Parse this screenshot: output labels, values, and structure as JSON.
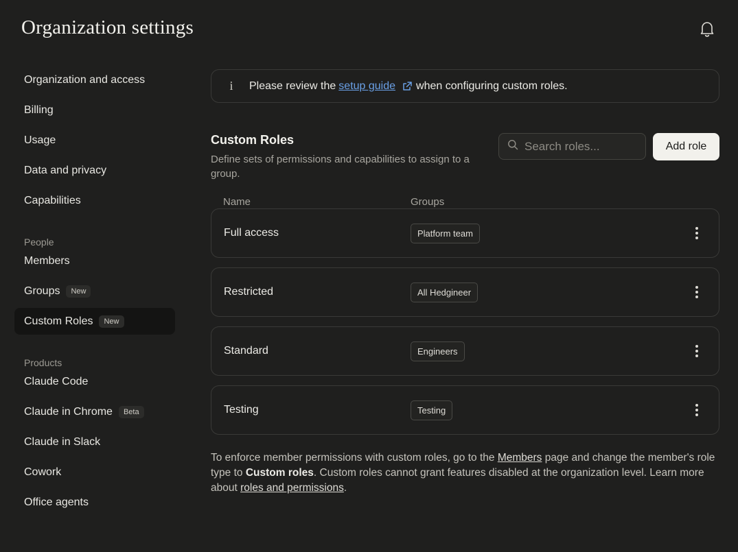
{
  "page_title": "Organization settings",
  "sidebar": {
    "items": [
      {
        "label": "Organization and access"
      },
      {
        "label": "Billing"
      },
      {
        "label": "Usage"
      },
      {
        "label": "Data and privacy"
      },
      {
        "label": "Capabilities"
      }
    ],
    "people_label": "People",
    "people_items": [
      {
        "label": "Members",
        "badge": ""
      },
      {
        "label": "Groups",
        "badge": "New"
      },
      {
        "label": "Custom Roles",
        "badge": "New"
      }
    ],
    "products_label": "Products",
    "product_items": [
      {
        "label": "Claude Code",
        "badge": ""
      },
      {
        "label": "Claude in Chrome",
        "badge": "Beta"
      },
      {
        "label": "Claude in Slack",
        "badge": ""
      },
      {
        "label": "Cowork",
        "badge": ""
      },
      {
        "label": "Office agents",
        "badge": ""
      }
    ]
  },
  "banner": {
    "prefix": "Please review the",
    "link": "setup guide",
    "suffix": "when configuring custom roles."
  },
  "roles": {
    "title": "Custom Roles",
    "description": "Define sets of permissions and capabilities to assign to a group.",
    "search_placeholder": "Search roles...",
    "add_button": "Add role",
    "col_name": "Name",
    "col_groups": "Groups",
    "rows": [
      {
        "name": "Full access",
        "group": "Platform team"
      },
      {
        "name": "Restricted",
        "group": "All Hedgineer"
      },
      {
        "name": "Standard",
        "group": "Engineers"
      },
      {
        "name": "Testing",
        "group": "Testing"
      }
    ]
  },
  "footer": {
    "part1": "To enforce member permissions with custom roles, go to the",
    "members_link": "Members",
    "part2": "page and change the member's role type to",
    "bold": "Custom roles",
    "part3": ". Custom roles cannot grant features disabled at the organization level. Learn more about",
    "roles_link": "roles and permissions",
    "part4": "."
  }
}
